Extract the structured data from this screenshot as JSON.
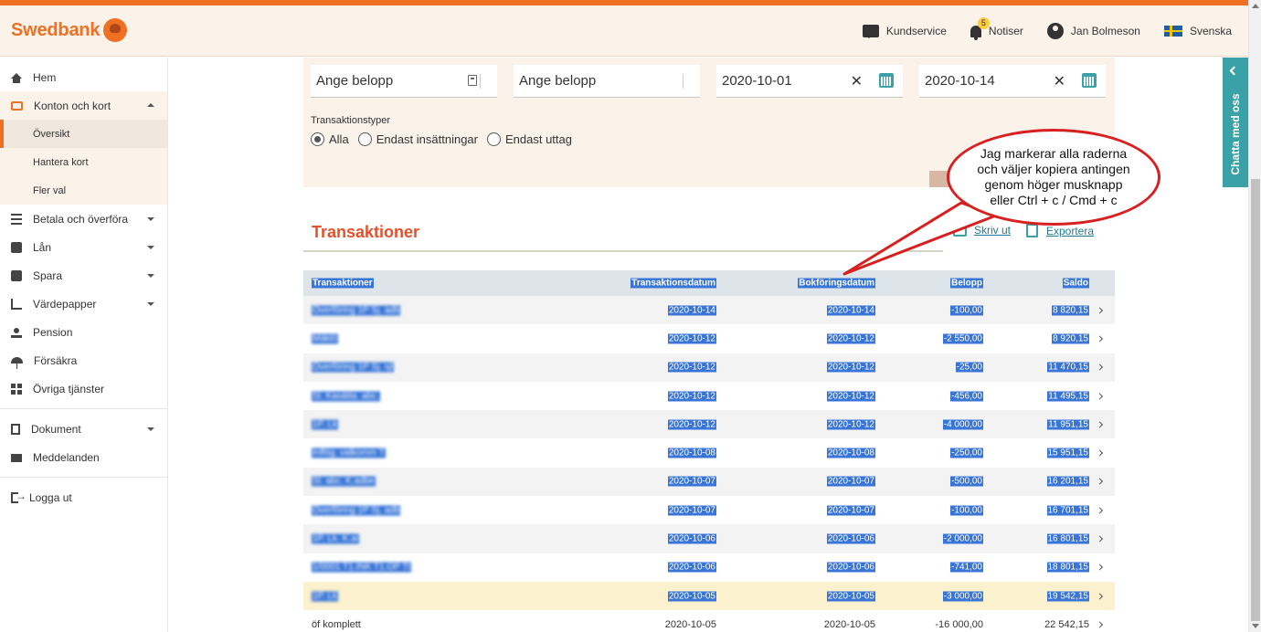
{
  "brand": {
    "name": "Swedbank",
    "accent": "#ee7023"
  },
  "header": {
    "items": [
      {
        "label": "Kundservice",
        "icon": "chat-icon"
      },
      {
        "label": "Notiser",
        "icon": "bell-icon",
        "badge": "5"
      },
      {
        "label": "Jan Bolmeson",
        "icon": "user-icon"
      },
      {
        "label": "Svenska",
        "icon": "swedish-flag-icon"
      }
    ]
  },
  "sidebar": {
    "items": [
      {
        "label": "Hem",
        "icon": "home-icon"
      },
      {
        "label": "Konton och kort",
        "icon": "cards-icon",
        "expanded": true,
        "children": [
          "Översikt",
          "Hantera kort",
          "Fler val"
        ],
        "active_child": "Översikt"
      },
      {
        "label": "Betala och överföra",
        "icon": "transfer-icon"
      },
      {
        "label": "Lån",
        "icon": "loan-icon"
      },
      {
        "label": "Spara",
        "icon": "savings-icon"
      },
      {
        "label": "Värdepapper",
        "icon": "chart-icon"
      },
      {
        "label": "Pension",
        "icon": "pension-icon"
      },
      {
        "label": "Försäkra",
        "icon": "umbrella-icon"
      },
      {
        "label": "Övriga tjänster",
        "icon": "grid-icon"
      },
      {
        "label": "Dokument",
        "icon": "document-icon"
      },
      {
        "label": "Meddelanden",
        "icon": "mail-icon"
      },
      {
        "label": "Logga ut",
        "icon": "logout-icon"
      }
    ]
  },
  "filters": {
    "amount_from_placeholder": "Ange belopp",
    "amount_to_placeholder": "Ange belopp",
    "date_from": "2020-10-01",
    "date_to": "2020-10-14",
    "types_label": "Transaktionstyper",
    "types": [
      "Alla",
      "Endast insättningar",
      "Endast uttag"
    ],
    "selected_type": "Alla"
  },
  "section": {
    "title": "Transaktioner",
    "print_label": "Skriv ut",
    "export_label": "Exportera"
  },
  "table": {
    "headers": [
      "Transaktioner",
      "Transaktionsdatum",
      "Bokföringsdatum",
      "Belopp",
      "Saldo"
    ],
    "rows": [
      {
        "desc": "Överföring 1P Sj. adb",
        "tdate": "2020-10-14",
        "bdate": "2020-10-14",
        "amount": "-100,00",
        "balance": "8 820,15",
        "selected": true
      },
      {
        "desc": "Mäklö",
        "tdate": "2020-10-12",
        "bdate": "2020-10-12",
        "amount": "-2 550,00",
        "balance": "8 920,15",
        "selected": true
      },
      {
        "desc": "Överföring 1P Sj. sjl",
        "tdate": "2020-10-12",
        "bdate": "2020-10-12",
        "amount": "-25,00",
        "balance": "11 470,15",
        "selected": true
      },
      {
        "desc": "Sl. Kasätta. abc.",
        "tdate": "2020-10-12",
        "bdate": "2020-10-12",
        "amount": "-456,00",
        "balance": "11 495,15",
        "selected": true
      },
      {
        "desc": "1P. Lk",
        "tdate": "2020-10-12",
        "bdate": "2020-10-12",
        "amount": "-4 000,00",
        "balance": "11 951,15",
        "selected": true
      },
      {
        "desc": "Inflög. valkomm T",
        "tdate": "2020-10-08",
        "bdate": "2020-10-08",
        "amount": "-250,00",
        "balance": "15 951,15",
        "selected": true
      },
      {
        "desc": "Sl. abc. K.adbe",
        "tdate": "2020-10-07",
        "bdate": "2020-10-07",
        "amount": "-500,00",
        "balance": "16 201,15",
        "selected": true
      },
      {
        "desc": "Överföring 1P Sj. adb",
        "tdate": "2020-10-07",
        "bdate": "2020-10-07",
        "amount": "-100,00",
        "balance": "16 701,15",
        "selected": true
      },
      {
        "desc": "1P. Lk. K.ai",
        "tdate": "2020-10-06",
        "bdate": "2020-10-06",
        "amount": "-2 000,00",
        "balance": "16 801,15",
        "selected": true
      },
      {
        "desc": "1/0001 T1.INK T1.OP Tt",
        "tdate": "2020-10-06",
        "bdate": "2020-10-06",
        "amount": "-741,00",
        "balance": "18 801,15",
        "selected": true
      },
      {
        "desc": "1P. Lk",
        "tdate": "2020-10-05",
        "bdate": "2020-10-05",
        "amount": "-3 000,00",
        "balance": "19 542,15",
        "selected": true
      },
      {
        "desc": "öf komplett",
        "tdate": "2020-10-05",
        "bdate": "2020-10-05",
        "amount": "-16 000,00",
        "balance": "22 542,15",
        "selected": false
      }
    ]
  },
  "callout": {
    "text": "Jag markerar alla raderna och väljer kopiera antingen genom höger musknapp eller Ctrl + c / Cmd + c"
  },
  "chat": {
    "label": "Chatta med oss"
  }
}
